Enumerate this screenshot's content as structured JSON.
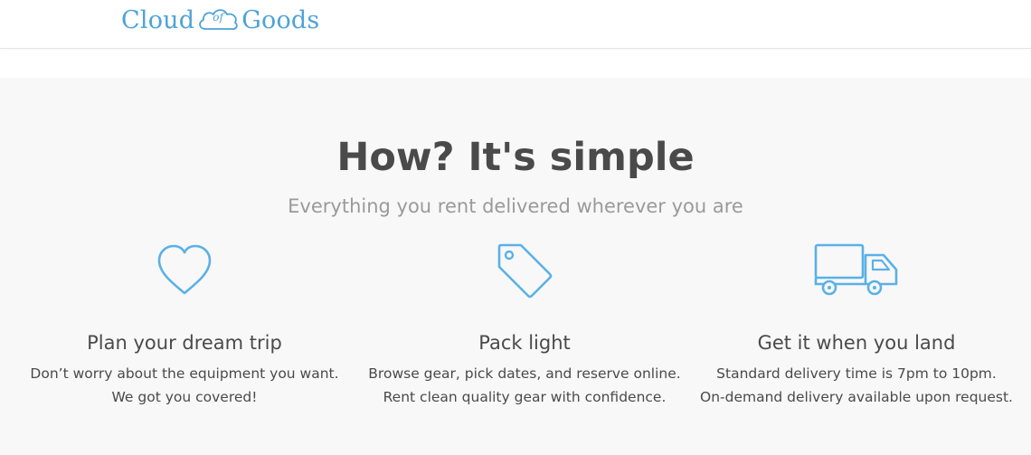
{
  "brand": {
    "name_left": "Cloud",
    "name_mid": "of",
    "name_right": "Goods",
    "accent_color": "#4ea3d8"
  },
  "how": {
    "headline": "How? It's simple",
    "subheadline": "Everything you rent delivered wherever you are",
    "features": [
      {
        "icon": "heart-icon",
        "title": "Plan your dream trip",
        "line1": "Don’t worry about the equipment you want.",
        "line2": "We got you covered!"
      },
      {
        "icon": "tag-icon",
        "title": "Pack light",
        "line1": "Browse gear, pick dates, and reserve online.",
        "line2": "Rent clean quality gear with confidence."
      },
      {
        "icon": "truck-icon",
        "title": "Get it when you land",
        "line1": "Standard delivery time is 7pm to 10pm.",
        "line2": "On-demand delivery available upon request."
      }
    ]
  },
  "colors": {
    "section_bg": "#f8f8f8",
    "text_dark": "#4a4a4a",
    "text_muted": "#9a9a9a",
    "icon_blue": "#5ab1e6"
  }
}
